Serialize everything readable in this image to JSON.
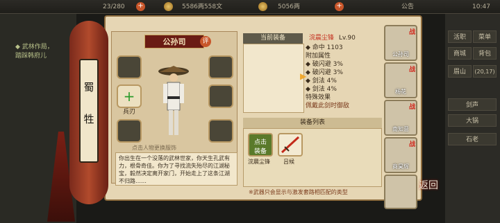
{
  "topbar": {
    "stamina": "23/280",
    "silver": "5586两558文",
    "gold": "5056两",
    "notice": "公告",
    "time": "10:47"
  },
  "quest": {
    "line1": "◆ 武林作局，",
    "line2": "踏踩韩府儿"
  },
  "side_menu": [
    "活职",
    "菜单",
    "商城",
    "背包",
    "眉山",
    "(20,17)",
    "剑声",
    "大锅",
    "石老"
  ],
  "rod_label": [
    "蜀",
    "牲"
  ],
  "character": {
    "name": "公孙司",
    "rate_badge": "评",
    "slot_label": "兵刃",
    "touch_hint": "点击人物更换服饰",
    "description": "你出生在一个没落的武林世家，你天生孔武有力，根骨奇佳。你为了寻找流失殆尽的江湖秘宝，毅然决定离开家门，开始走上了这条江湖不归路……"
  },
  "equipped": {
    "title": "当前装备",
    "weapon_name": "浣晨尘锋",
    "weapon_level": "Lv.90",
    "stats": [
      "◆ 命中 1103",
      "附加属性",
      "◆ 破闪避 3%",
      "◆ 破闪避 3%",
      "◆ 剑法 4%",
      "◆ 剑法 4%",
      "特殊效果",
      "佩戴此剑时御敌"
    ]
  },
  "equip_list": {
    "title": "装备列表",
    "button_label": "点击\n装备",
    "items": [
      "浣晨尘锋",
      "吕候"
    ],
    "footnote": "※武器只会显示与激发套路相匹配的类型"
  },
  "roster": {
    "war_tag": "战",
    "members": [
      "公孙司",
      "杨花",
      "南知意",
      "商昊辉",
      ""
    ]
  },
  "back_button": "返回"
}
